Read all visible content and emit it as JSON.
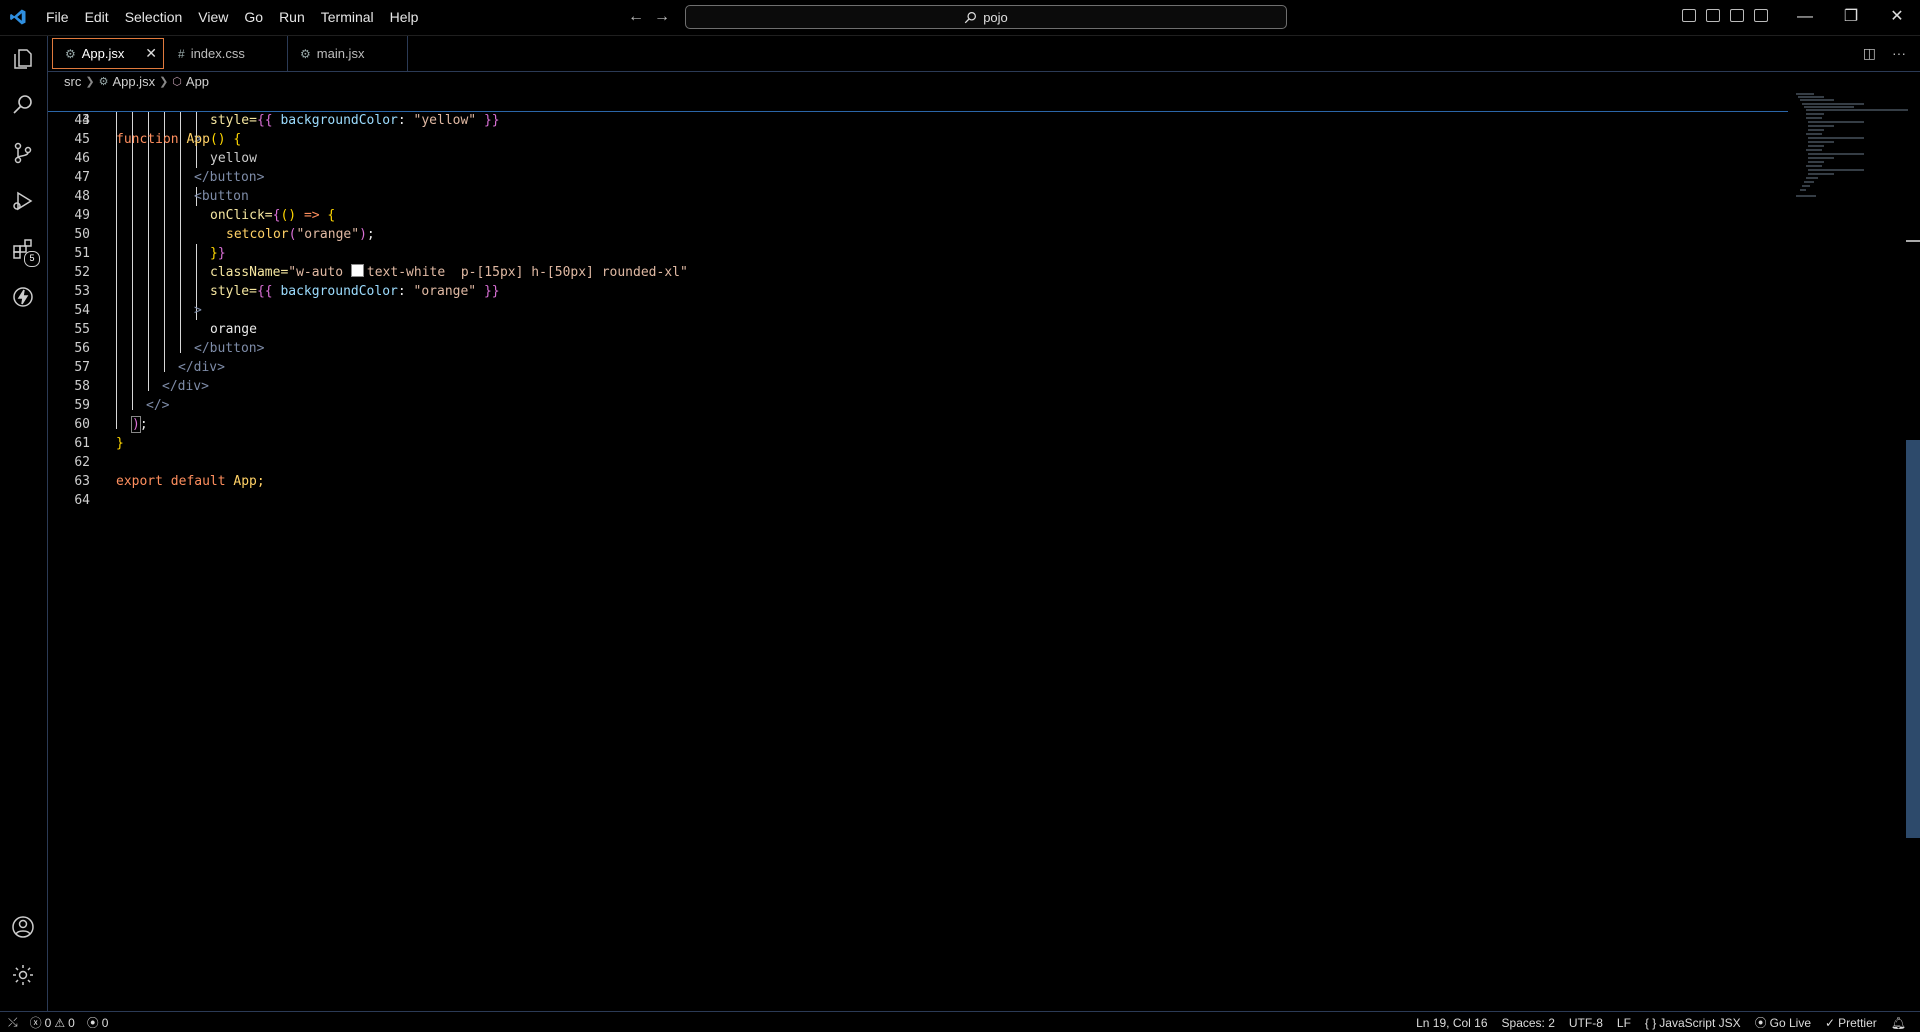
{
  "menu": [
    "File",
    "Edit",
    "Selection",
    "View",
    "Go",
    "Run",
    "Terminal",
    "Help"
  ],
  "search": {
    "text": "pojo"
  },
  "tabs": [
    {
      "label": "App.jsx",
      "icon": "⚙",
      "active": true
    },
    {
      "label": "index.css",
      "icon": "#",
      "active": false
    },
    {
      "label": "main.jsx",
      "icon": "⚙",
      "active": false
    }
  ],
  "breadcrumb": [
    "src",
    "App.jsx",
    "App"
  ],
  "extensions_badge": "5",
  "sticky": {
    "num": "3",
    "code": "function App() {"
  },
  "lines": [
    {
      "num": "44"
    },
    {
      "num": "45"
    },
    {
      "num": "46"
    },
    {
      "num": "47"
    },
    {
      "num": "48"
    },
    {
      "num": "49"
    },
    {
      "num": "50"
    },
    {
      "num": "51"
    },
    {
      "num": "52"
    },
    {
      "num": "53"
    },
    {
      "num": "54"
    },
    {
      "num": "55"
    },
    {
      "num": "56"
    },
    {
      "num": "57"
    },
    {
      "num": "58"
    },
    {
      "num": "59"
    },
    {
      "num": "60"
    },
    {
      "num": "61"
    },
    {
      "num": "62"
    },
    {
      "num": "63"
    },
    {
      "num": "64"
    }
  ],
  "code_text": {
    "l44_style": "style=",
    "l44_prop": "backgroundColor",
    "l44_val": "\"yellow\"",
    "l46": "yellow",
    "l47": "</button>",
    "l48": "<button",
    "l49_attr": "onClick=",
    "l50_fn": "setcolor",
    "l50_str": "\"orange\"",
    "l52_attr": "className=",
    "l52_a": "\"w-auto ",
    "l52_b": "text-white  p-[15px] h-[50px] rounded-xl\"",
    "l53_style": "style=",
    "l53_prop": "backgroundColor",
    "l53_val": "\"orange\"",
    "l55": "orange",
    "l56": "</button>",
    "l57": "</div>",
    "l58": "</div>",
    "l59": "</>",
    "l63_kw": "export default",
    "l63_id": "App;"
  },
  "status": {
    "errors": "0",
    "warnings": "0",
    "ports": "0",
    "position": "Ln 19, Col 16",
    "spaces": "Spaces: 2",
    "encoding": "UTF-8",
    "eol": "LF",
    "language": "JavaScript JSX",
    "golive": "Go Live",
    "prettier": "Prettier"
  }
}
